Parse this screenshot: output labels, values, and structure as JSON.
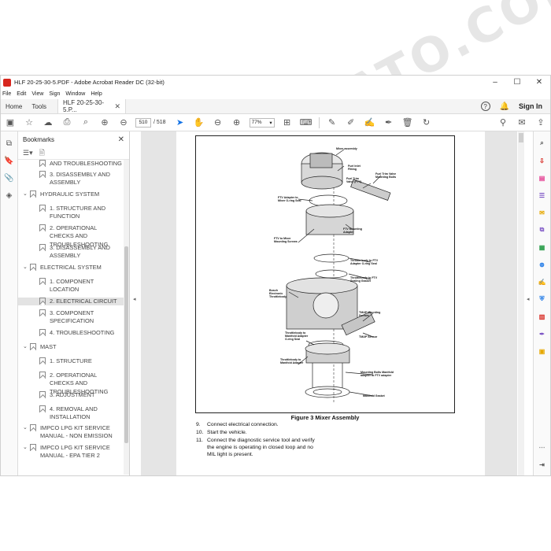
{
  "window": {
    "title": "HLF 20-25-30-5.PDF - Adobe Acrobat Reader DC (32-bit)"
  },
  "menu": [
    "File",
    "Edit",
    "View",
    "Sign",
    "Window",
    "Help"
  ],
  "tabs": {
    "home": "Home",
    "tools": "Tools",
    "doc": "HLF 20-25-30-5.P..."
  },
  "header": {
    "sign_in": "Sign In"
  },
  "toolbar": {
    "page_current": "510",
    "page_total": "/ 518",
    "zoom": "77%"
  },
  "bookmarks": {
    "title": "Bookmarks",
    "items": [
      {
        "label": "AND TROUBLESHOOTING",
        "level": 2
      },
      {
        "label": "3. DISASSEMBLY AND ASSEMBLY",
        "level": 2
      },
      {
        "label": "HYDRAULIC SYSTEM",
        "level": 1
      },
      {
        "label": "1. STRUCTURE AND FUNCTION",
        "level": 2
      },
      {
        "label": "2. OPERATIONAL CHECKS AND TROUBLESHOOTING",
        "level": 2
      },
      {
        "label": "3. DISASSEMBLY AND ASSEMBLY",
        "level": 2
      },
      {
        "label": "ELECTRICAL SYSTEM",
        "level": 1
      },
      {
        "label": "1. COMPONENT LOCATION",
        "level": 2
      },
      {
        "label": "2. ELECTRICAL CIRCUIT",
        "level": 2,
        "selected": true
      },
      {
        "label": "3. COMPONENT SPECIFICATION",
        "level": 2
      },
      {
        "label": "4. TROUBLESHOOTING",
        "level": 2
      },
      {
        "label": "MAST",
        "level": 1
      },
      {
        "label": "1. STRUCTURE",
        "level": 2
      },
      {
        "label": "2. OPERATIONAL CHECKS AND TROUBLESHOOTING",
        "level": 2
      },
      {
        "label": "3. ADJUSTMENT",
        "level": 2
      },
      {
        "label": "4. REMOVAL AND INSTALLATION",
        "level": 2
      },
      {
        "label": "IMPCO LPG KIT SERVICE MANUAL - NON EMISSION",
        "level": 1
      },
      {
        "label": "IMPCO LPG KIT SERVICE MANUAL - EPA TIER 2",
        "level": 1
      }
    ]
  },
  "document": {
    "figure_labels": [
      "Mixer assembly",
      "Fuel Inlet Fitting",
      "Fuel Trim Valve Mounting Bolts",
      "Fuel Trim Valve (FTV)",
      "FTV Adapter to Mixer O-ring Seal",
      "FTV Mounting Adapter",
      "FTV to Mixer Mounting Screws",
      "Throttle body to FTV Adapter O-ring Seal",
      "Throttlebody to FTV Sealing Gasket",
      "Bosch Electronic Throttlebody",
      "TMAP Mounting Screws",
      "TMAP Sensor",
      "Throttlebody to Manifold Adapter O-ring Seal",
      "Throttlebody to Manifold Adapter",
      "Mounting Bolts Manifold adapter to FTV adapter",
      "Manifold Gasket"
    ],
    "caption": "Figure 3 Mixer Assembly",
    "steps": [
      {
        "num": "9.",
        "text": "Connect electrical connection."
      },
      {
        "num": "10.",
        "text": "Start the vehicle."
      },
      {
        "num": "11.",
        "text": "Connect  the diagnostic service tool and verify the engine is operating in closed loop and no MIL  light is present."
      }
    ]
  },
  "watermark": "WWW.EPCDATO.COM",
  "colors": {
    "accent": "#1473e6",
    "acrobat_red": "#d7261e",
    "selection": "#e3e3e3"
  }
}
